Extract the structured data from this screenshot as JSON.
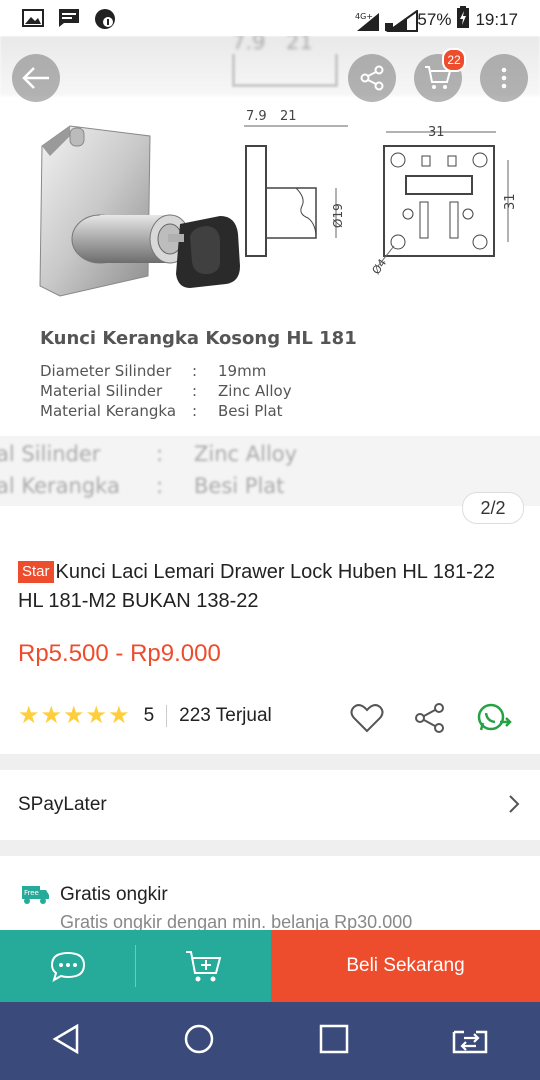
{
  "status_bar": {
    "network_label": "4G+",
    "battery_percent": "57%",
    "time": "19:17"
  },
  "top_bar": {
    "cart_count": "22"
  },
  "image": {
    "pager": "2/2",
    "dimension_top_a": "7.9",
    "dimension_top_b": "21",
    "dimension_width": "31",
    "dimension_height": "31",
    "dimension_diameter": "Ø19",
    "dimension_hole": "Ø4",
    "product_title": "Kunci Kerangka Kosong HL 181",
    "specs": [
      {
        "key": "Diameter Silinder",
        "colon": ":",
        "value": "19mm"
      },
      {
        "key": "Material Silinder",
        "colon": ":",
        "value": "Zinc Alloy"
      },
      {
        "key": "Material Kerangka",
        "colon": ":",
        "value": "Besi Plat"
      }
    ],
    "ghost_rows": [
      {
        "key": "al Silinder",
        "colon": ":",
        "value": "Zinc Alloy"
      },
      {
        "key": "al Kerangka",
        "colon": ":",
        "value": "Besi Plat"
      }
    ],
    "ghost_top": [
      "7.9",
      "21"
    ]
  },
  "product": {
    "badge": "Star",
    "title": "Kunci Laci Lemari Drawer Lock Huben HL 181-22 HL 181-M2 BUKAN 138-22",
    "price": "Rp5.500 - Rp9.000",
    "rating": 5,
    "rating_text": "5",
    "sold": "223 Terjual"
  },
  "spaylater": {
    "label": "SPayLater"
  },
  "shipping": {
    "free_label": "Free",
    "title": "Gratis ongkir",
    "subtitle": "Gratis ongkir dengan min. belanja Rp30.000"
  },
  "bottom_bar": {
    "buy_label": "Beli Sekarang"
  },
  "colors": {
    "brand": "#ee4d2d",
    "teal": "#26aa99",
    "star": "#ffce3d",
    "navbar": "#3a4a7a"
  }
}
